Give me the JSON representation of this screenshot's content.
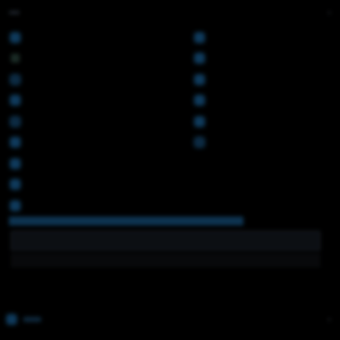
{
  "header": {
    "title": "",
    "control": "›"
  },
  "left_rows": [
    {
      "label": "",
      "state": "on"
    },
    {
      "label": "",
      "state": "off"
    },
    {
      "label": "",
      "state": "dim"
    },
    {
      "label": "",
      "state": "on"
    },
    {
      "label": "",
      "state": "dim"
    },
    {
      "label": "",
      "state": "on"
    },
    {
      "label": "",
      "state": "on"
    },
    {
      "label": "",
      "state": "on"
    },
    {
      "label": "",
      "state": "on"
    }
  ],
  "right_rows": [
    {
      "label": "",
      "state": "on"
    },
    {
      "label": "",
      "state": "on"
    },
    {
      "label": "",
      "state": "on"
    },
    {
      "label": "",
      "state": "on"
    },
    {
      "label": "",
      "state": "on"
    },
    {
      "label": "",
      "state": "dim"
    }
  ],
  "panel_a": "",
  "panel_b": "",
  "note": "",
  "footer": {
    "title": "",
    "arrow": "›"
  }
}
